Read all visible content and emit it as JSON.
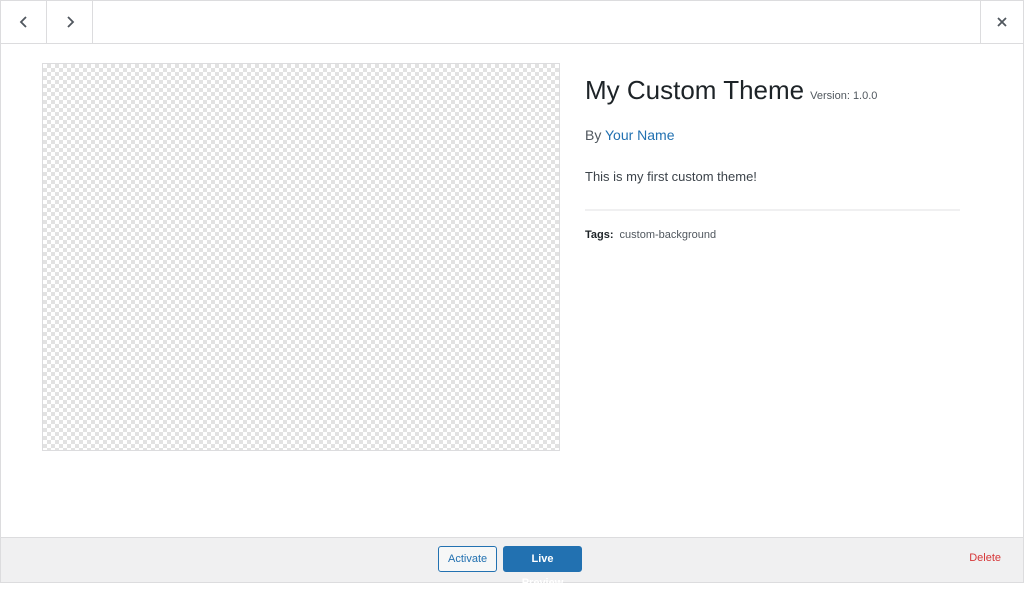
{
  "theme": {
    "name": "My Custom Theme",
    "version": "Version: 1.0.0",
    "author_prefix": "By",
    "author_name": "Your Name",
    "description": "This is my first custom theme!",
    "tags_label": "Tags:",
    "tags": "custom-background"
  },
  "footer": {
    "activate_label": "Activate",
    "live_preview_label": "Live Preview",
    "delete_label": "Delete"
  },
  "icons": {
    "previous": "chevron-left-icon",
    "next": "chevron-right-icon",
    "close": "close-icon"
  },
  "colors": {
    "accent": "#2271b1",
    "delete": "#d63638",
    "footer_bg": "#f0f0f1"
  }
}
